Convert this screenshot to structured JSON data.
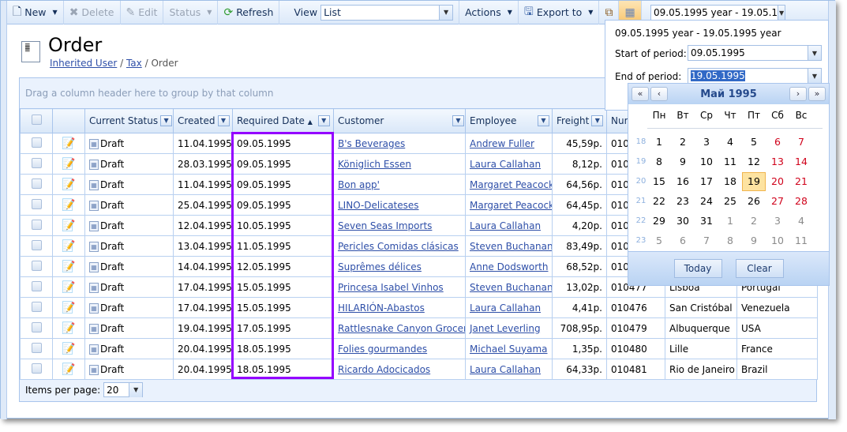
{
  "toolbar": {
    "new": "New",
    "delete": "Delete",
    "edit": "Edit",
    "status": "Status",
    "refresh": "Refresh",
    "view_label": "View",
    "view_value": "List",
    "actions": "Actions",
    "export": "Export to",
    "date_range": "09.05.1995 year - 19.05.1"
  },
  "page": {
    "title": "Order",
    "breadcrumb": [
      "Inherited User",
      "Tax",
      "Order"
    ]
  },
  "grid": {
    "group_hint": "Drag a column header here to group by that column",
    "columns": [
      "Current Status",
      "Created",
      "Required Date",
      "Customer",
      "Employee",
      "Freight",
      "Num"
    ],
    "sorted_column": "Required Date",
    "sort_direction": "ascending",
    "rows": [
      {
        "status": "Draft",
        "created": "11.04.1995",
        "required": "09.05.1995",
        "customer": "B's Beverages",
        "employee": "Andrew Fuller",
        "freight": "45,59р.",
        "number": "010",
        "city": "",
        "country": ""
      },
      {
        "status": "Draft",
        "created": "28.03.1995",
        "required": "09.05.1995",
        "customer": "Königlich Essen",
        "employee": "Laura Callahan",
        "freight": "8,12р.",
        "number": "010",
        "city": "",
        "country": ""
      },
      {
        "status": "Draft",
        "created": "11.04.1995",
        "required": "09.05.1995",
        "customer": "Bon app'",
        "employee": "Margaret Peacock",
        "freight": "64,56р.",
        "number": "010",
        "city": "",
        "country": ""
      },
      {
        "status": "Draft",
        "created": "25.04.1995",
        "required": "09.05.1995",
        "customer": "LINO-Delicateses",
        "employee": "Margaret Peacock",
        "freight": "64,45р.",
        "number": "010",
        "city": "",
        "country": ""
      },
      {
        "status": "Draft",
        "created": "12.04.1995",
        "required": "10.05.1995",
        "customer": "Seven Seas Imports",
        "employee": "Laura Callahan",
        "freight": "4,20р.",
        "number": "010",
        "city": "",
        "country": ""
      },
      {
        "status": "Draft",
        "created": "13.04.1995",
        "required": "11.05.1995",
        "customer": "Pericles Comidas clásicas",
        "employee": "Steven Buchanan",
        "freight": "83,49р.",
        "number": "010",
        "city": "",
        "country": ""
      },
      {
        "status": "Draft",
        "created": "14.04.1995",
        "required": "12.05.1995",
        "customer": "Suprêmes délices",
        "employee": "Anne Dodsworth",
        "freight": "68,52р.",
        "number": "010",
        "city": "",
        "country": ""
      },
      {
        "status": "Draft",
        "created": "17.04.1995",
        "required": "15.05.1995",
        "customer": "Princesa Isabel Vinhos",
        "employee": "Steven Buchanan",
        "freight": "13,02р.",
        "number": "010477",
        "city": "Lisboa",
        "country": "Portugal"
      },
      {
        "status": "Draft",
        "created": "17.04.1995",
        "required": "15.05.1995",
        "customer": "HILARIÓN-Abastos",
        "employee": "Laura Callahan",
        "freight": "4,41р.",
        "number": "010476",
        "city": "San Cristóbal",
        "country": "Venezuela"
      },
      {
        "status": "Draft",
        "created": "19.04.1995",
        "required": "17.05.1995",
        "customer": "Rattlesnake Canyon Grocery",
        "employee": "Janet Leverling",
        "freight": "708,95р.",
        "number": "010479",
        "city": "Albuquerque",
        "country": "USA"
      },
      {
        "status": "Draft",
        "created": "20.04.1995",
        "required": "18.05.1995",
        "customer": "Folies gourmandes",
        "employee": "Michael Suyama",
        "freight": "1,35р.",
        "number": "010480",
        "city": "Lille",
        "country": "France"
      },
      {
        "status": "Draft",
        "created": "20.04.1995",
        "required": "18.05.1995",
        "customer": "Ricardo Adocicados",
        "employee": "Laura Callahan",
        "freight": "64,33р.",
        "number": "010481",
        "city": "Rio de Janeiro",
        "country": "Brazil"
      }
    ],
    "items_per_page_label": "Items per page:",
    "items_per_page": "20"
  },
  "period": {
    "summary": "09.05.1995 year - 19.05.1995 year",
    "start_label": "Start of period:",
    "start_value": "09.05.1995",
    "end_label": "End of period:",
    "end_value": "19.05.1995"
  },
  "calendar": {
    "month": "Май 1995",
    "day_names": [
      "Пн",
      "Вт",
      "Ср",
      "Чт",
      "Пт",
      "Сб",
      "Вс"
    ],
    "weeks": [
      {
        "n": "18",
        "days": [
          "1",
          "2",
          "3",
          "4",
          "5",
          "6",
          "7"
        ]
      },
      {
        "n": "19",
        "days": [
          "8",
          "9",
          "10",
          "11",
          "12",
          "13",
          "14"
        ]
      },
      {
        "n": "20",
        "days": [
          "15",
          "16",
          "17",
          "18",
          "19",
          "20",
          "21"
        ]
      },
      {
        "n": "21",
        "days": [
          "22",
          "23",
          "24",
          "25",
          "26",
          "27",
          "28"
        ]
      },
      {
        "n": "22",
        "days": [
          "29",
          "30",
          "31",
          "1",
          "2",
          "3",
          "4"
        ]
      },
      {
        "n": "23",
        "days": [
          "5",
          "6",
          "7",
          "8",
          "9",
          "10",
          "11"
        ]
      }
    ],
    "selected": "19",
    "today_label": "Today",
    "clear_label": "Clear"
  },
  "colors": {
    "highlight": "#9400ff",
    "accent": "#254a8c",
    "weekend": "#d0021b",
    "selected_day": "#fde3a1"
  }
}
